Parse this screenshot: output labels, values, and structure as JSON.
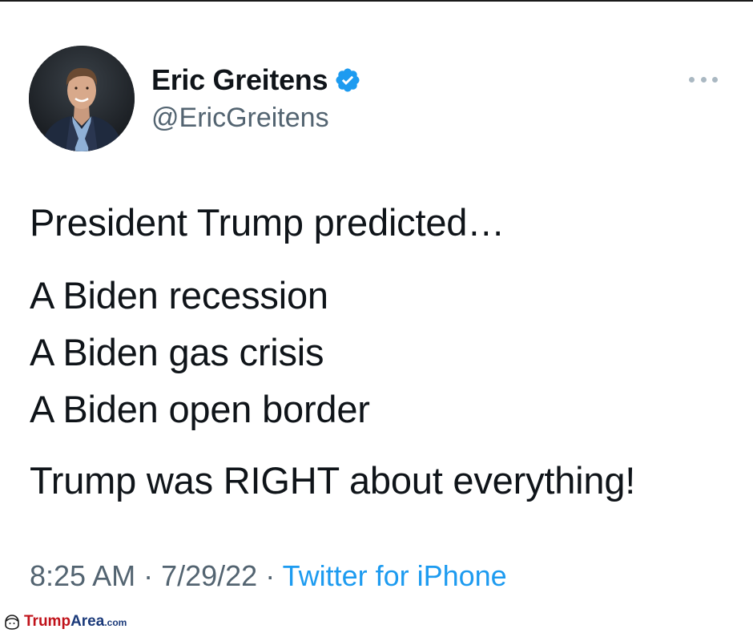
{
  "tweet": {
    "author": {
      "display_name": "Eric Greitens",
      "handle": "@EricGreitens",
      "verified": true,
      "verified_icon": "verified-badge-icon",
      "avatar": "profile-photo"
    },
    "more_icon": "more-options-icon",
    "text": {
      "intro": "President Trump predicted…",
      "lines": [
        "A Biden recession",
        "A Biden gas crisis",
        "A Biden open border"
      ],
      "closing": "Trump was RIGHT about everything!"
    },
    "meta": {
      "time": "8:25 AM",
      "separator": " · ",
      "date": "7/29/22",
      "source": "Twitter for iPhone"
    }
  },
  "watermark": {
    "trump": "Trump",
    "area": "Area",
    "com": ".com",
    "logo_icon": "trumparea-logo-icon"
  },
  "colors": {
    "text": "#0f1419",
    "secondary": "#536471",
    "link": "#1d9bf0",
    "verified": "#1d9bf0",
    "watermark_red": "#c0121a",
    "watermark_blue": "#1b3a7a"
  }
}
